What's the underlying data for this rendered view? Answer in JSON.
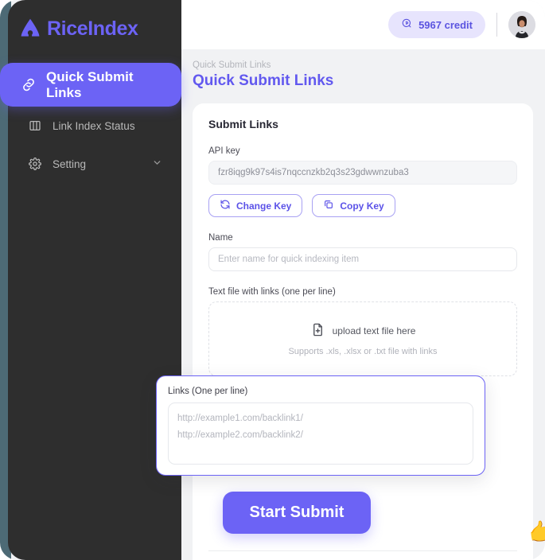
{
  "brand": {
    "name": "RiceIndex",
    "logo_icon": "rice-arrow-logo-icon",
    "accent_color": "#6C63F5"
  },
  "sidebar": {
    "items": [
      {
        "label": "Quick Submit Links",
        "icon": "link-chain-icon",
        "active": true,
        "has_chevron": false
      },
      {
        "label": "Link Index Status",
        "icon": "panel-layout-icon",
        "active": false,
        "has_chevron": false
      },
      {
        "label": "Setting",
        "icon": "gear-icon",
        "active": false,
        "has_chevron": true
      }
    ]
  },
  "topbar": {
    "credit_label": "5967 credit",
    "credit_icon": "coin-icon",
    "avatar_alt": "user-avatar"
  },
  "breadcrumb": "Quick Submit Links",
  "page_title": "Quick Submit Links",
  "card": {
    "title": "Submit Links",
    "api_key": {
      "label": "API key",
      "value": "fzr8iqg9k97s4is7nqccnzkb2q3s23gdwwnzuba3",
      "change_button": "Change Key",
      "change_icon": "refresh-icon",
      "copy_button": "Copy Key",
      "copy_icon": "copy-icon"
    },
    "name_field": {
      "label": "Name",
      "value": "",
      "placeholder": "Enter name for quick indexing item"
    },
    "upload": {
      "label": "Text file with links (one per line)",
      "icon": "file-upload-icon",
      "primary_text": "upload text file here",
      "secondary_text": "Supports .xls, .xlsx or .txt file with links"
    },
    "submit_button": "Start Submit"
  },
  "links_panel": {
    "label": "Links (One per line)",
    "value": "",
    "placeholder_lines": [
      "http://example1.com/backlink1/",
      "http://example2.com/backlink2/"
    ]
  },
  "cursor": {
    "icon": "pointing-hand-cursor"
  }
}
